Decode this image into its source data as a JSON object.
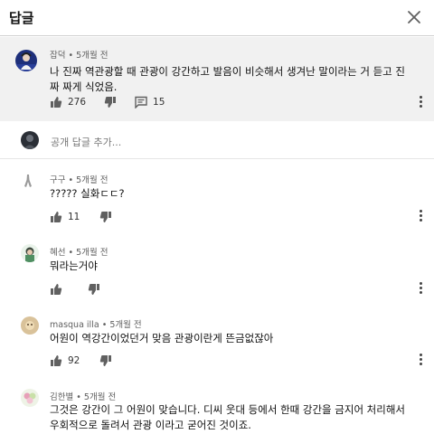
{
  "header": {
    "title": "답글"
  },
  "top_comment": {
    "author": "잡덕",
    "time": "5개월 전",
    "text": "나 진짜 역관광할 때 관광이 강간하고 발음이 비슷해서 생겨난 말이라는 거 듣고 진짜 짜게 식었음.",
    "likes": "276",
    "replies": "15"
  },
  "add_reply": {
    "placeholder": "공개 답글 추가..."
  },
  "replies": [
    {
      "author": "구구",
      "time": "5개월 전",
      "text": "????? 실화ㄷㄷ?",
      "likes": "11"
    },
    {
      "author": "혜선",
      "time": "5개월 전",
      "text": "뭐라는거야",
      "likes": ""
    },
    {
      "author": "masqua illa",
      "time": "5개월 전",
      "text": "어원이 역강간이었던거 맞음 관광이란게 뜬금없잖아",
      "likes": "92"
    },
    {
      "author": "김한별",
      "time": "5개월 전",
      "text": "그것은 강간이 그 어원이 맞습니다. 디씨 웃대 등에서 한때 강간을 금지어 처리해서 우회적으로 돌려서 관광 이라고 굳어진 것이죠.",
      "likes": ""
    }
  ],
  "separator": "•",
  "colors": {
    "top_comment_bg": "#f1f1f1",
    "meta_text": "#606060",
    "icon": "#606060"
  }
}
